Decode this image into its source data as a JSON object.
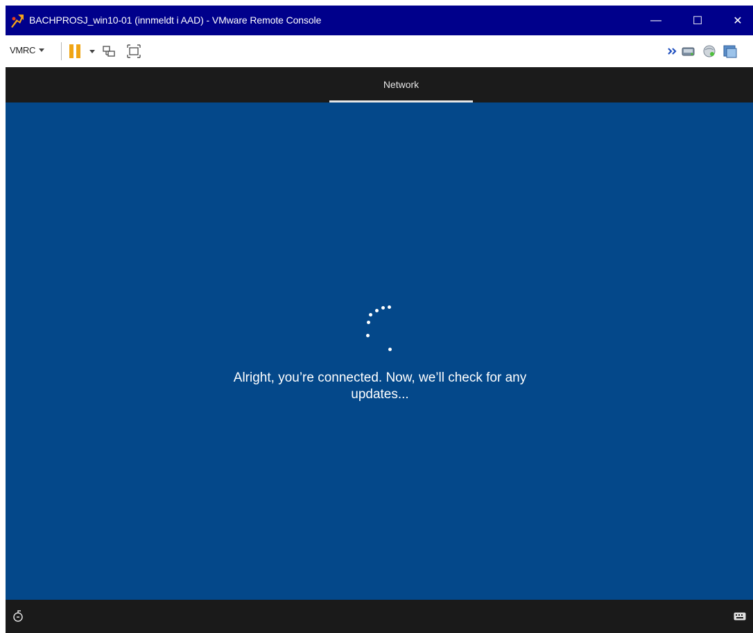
{
  "window": {
    "title": "BACHPROSJ_win10-01 (innmeldt i AAD) - VMware Remote Console",
    "controls": [
      "minimize-icon",
      "maximize-icon",
      "close-icon"
    ],
    "minimize_glyph": "—",
    "maximize_glyph": "☐",
    "close_glyph": "✕"
  },
  "toolbar": {
    "vmrc_label": "VMRC",
    "icons": [
      "pause-icon",
      "send-ctrl-alt-del-icon",
      "fullscreen-icon",
      "overflow-chevron-icon",
      "removable-device-icon",
      "network-adapter-icon",
      "vmware-tools-icon"
    ],
    "accent_pause": "#f0a515"
  },
  "network_bar": {
    "tab_label": "Network"
  },
  "screen": {
    "background": "#04488a",
    "message_line1": "Alright, you’re connected. Now, we’ll check for any",
    "message_line2": "updates..."
  },
  "bottombar": {
    "icons": [
      "accessibility-icon",
      "keyboard-icon"
    ]
  }
}
